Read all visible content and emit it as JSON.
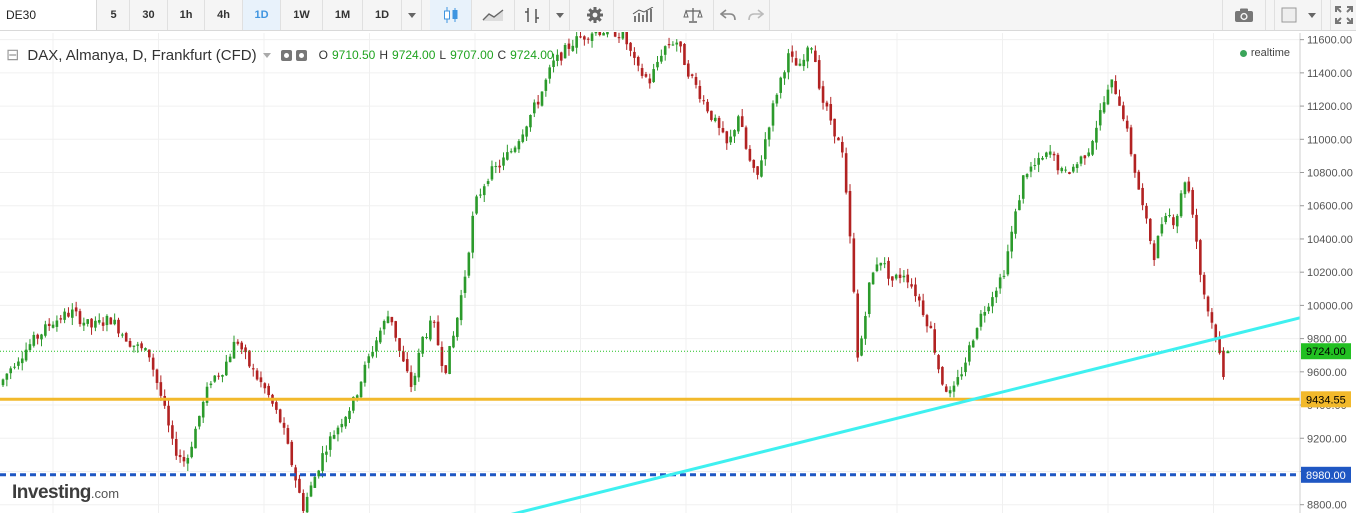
{
  "toolbar": {
    "symbol": "DE30",
    "intervals": [
      {
        "label": "5",
        "active": false
      },
      {
        "label": "30",
        "active": false
      },
      {
        "label": "1h",
        "active": false
      },
      {
        "label": "4h",
        "active": false
      },
      {
        "label": "1D",
        "active": true
      },
      {
        "label": "1W",
        "active": false
      },
      {
        "label": "1M",
        "active": false
      },
      {
        "label": "1D",
        "active": false
      }
    ]
  },
  "legend": {
    "title": "DAX, Almanya, D, Frankfurt (CFD)",
    "o_label": "O",
    "o_value": "9710.50",
    "h_label": "H",
    "h_value": "9724.00",
    "l_label": "L",
    "l_value": "9707.00",
    "c_label": "C",
    "c_value": "9724.00"
  },
  "realtime_label": "realtime",
  "logo": {
    "brand": "Investing",
    "suffix": ".com"
  },
  "colors": {
    "up": "#2b9a2b",
    "down": "#b22222",
    "trendline": "#3ef0f0",
    "support": "#f2b92b",
    "dashed_level": "#1f57c3",
    "price_tag": "#22c022",
    "accent": "#3f95e0"
  },
  "chart_data": {
    "type": "candlestick",
    "yaxis_ticks": [
      11600,
      11400,
      11200,
      11000,
      10800,
      10600,
      10400,
      10200,
      10000,
      9800,
      9600,
      9400,
      9200,
      9000,
      8800
    ],
    "ylim": [
      8750,
      11640
    ],
    "current_price": 9724.0,
    "current_price_label": "9724.00",
    "support_level": 9434.55,
    "support_label": "9434.55",
    "dashed_level": 8980.0,
    "dashed_label": "8980.00",
    "trendline": {
      "start": {
        "t": 0.39,
        "price": 8735
      },
      "end": {
        "t": 1.0,
        "price": 9925
      }
    },
    "trend_waypoints": [
      [
        0.0,
        9520
      ],
      [
        0.01,
        9650
      ],
      [
        0.025,
        9780
      ],
      [
        0.04,
        9900
      ],
      [
        0.055,
        9960
      ],
      [
        0.07,
        9870
      ],
      [
        0.085,
        9920
      ],
      [
        0.1,
        9780
      ],
      [
        0.115,
        9700
      ],
      [
        0.125,
        9420
      ],
      [
        0.133,
        9150
      ],
      [
        0.143,
        9050
      ],
      [
        0.152,
        9300
      ],
      [
        0.162,
        9550
      ],
      [
        0.172,
        9620
      ],
      [
        0.182,
        9800
      ],
      [
        0.193,
        9620
      ],
      [
        0.205,
        9480
      ],
      [
        0.217,
        9280
      ],
      [
        0.226,
        9000
      ],
      [
        0.233,
        8780
      ],
      [
        0.24,
        8920
      ],
      [
        0.25,
        9140
      ],
      [
        0.262,
        9300
      ],
      [
        0.272,
        9420
      ],
      [
        0.282,
        9650
      ],
      [
        0.292,
        9840
      ],
      [
        0.3,
        9960
      ],
      [
        0.308,
        9700
      ],
      [
        0.317,
        9500
      ],
      [
        0.325,
        9800
      ],
      [
        0.333,
        9900
      ],
      [
        0.342,
        9600
      ],
      [
        0.35,
        9850
      ],
      [
        0.358,
        10200
      ],
      [
        0.365,
        10600
      ],
      [
        0.375,
        10780
      ],
      [
        0.385,
        10850
      ],
      [
        0.395,
        10950
      ],
      [
        0.405,
        11100
      ],
      [
        0.415,
        11250
      ],
      [
        0.425,
        11450
      ],
      [
        0.44,
        11580
      ],
      [
        0.455,
        11650
      ],
      [
        0.47,
        11660
      ],
      [
        0.48,
        11620
      ],
      [
        0.49,
        11420
      ],
      [
        0.5,
        11350
      ],
      [
        0.51,
        11550
      ],
      [
        0.52,
        11600
      ],
      [
        0.53,
        11400
      ],
      [
        0.54,
        11250
      ],
      [
        0.55,
        11100
      ],
      [
        0.56,
        10950
      ],
      [
        0.568,
        11150
      ],
      [
        0.575,
        10900
      ],
      [
        0.582,
        10750
      ],
      [
        0.59,
        11050
      ],
      [
        0.598,
        11300
      ],
      [
        0.606,
        11500
      ],
      [
        0.615,
        11420
      ],
      [
        0.625,
        11580
      ],
      [
        0.632,
        11250
      ],
      [
        0.64,
        11100
      ],
      [
        0.648,
        10900
      ],
      [
        0.655,
        10300
      ],
      [
        0.66,
        9650
      ],
      [
        0.668,
        10100
      ],
      [
        0.676,
        10300
      ],
      [
        0.686,
        10150
      ],
      [
        0.696,
        10200
      ],
      [
        0.706,
        10050
      ],
      [
        0.716,
        9850
      ],
      [
        0.724,
        9550
      ],
      [
        0.732,
        9450
      ],
      [
        0.742,
        9650
      ],
      [
        0.752,
        9900
      ],
      [
        0.762,
        10050
      ],
      [
        0.772,
        10200
      ],
      [
        0.78,
        10500
      ],
      [
        0.788,
        10800
      ],
      [
        0.798,
        10850
      ],
      [
        0.808,
        10920
      ],
      [
        0.818,
        10780
      ],
      [
        0.828,
        10850
      ],
      [
        0.838,
        10950
      ],
      [
        0.848,
        11200
      ],
      [
        0.856,
        11350
      ],
      [
        0.864,
        11150
      ],
      [
        0.872,
        10850
      ],
      [
        0.88,
        10550
      ],
      [
        0.888,
        10300
      ],
      [
        0.896,
        10580
      ],
      [
        0.904,
        10500
      ],
      [
        0.912,
        10780
      ],
      [
        0.918,
        10550
      ],
      [
        0.924,
        10150
      ],
      [
        0.93,
        9950
      ],
      [
        0.936,
        9800
      ],
      [
        0.943,
        9470
      ]
    ]
  }
}
